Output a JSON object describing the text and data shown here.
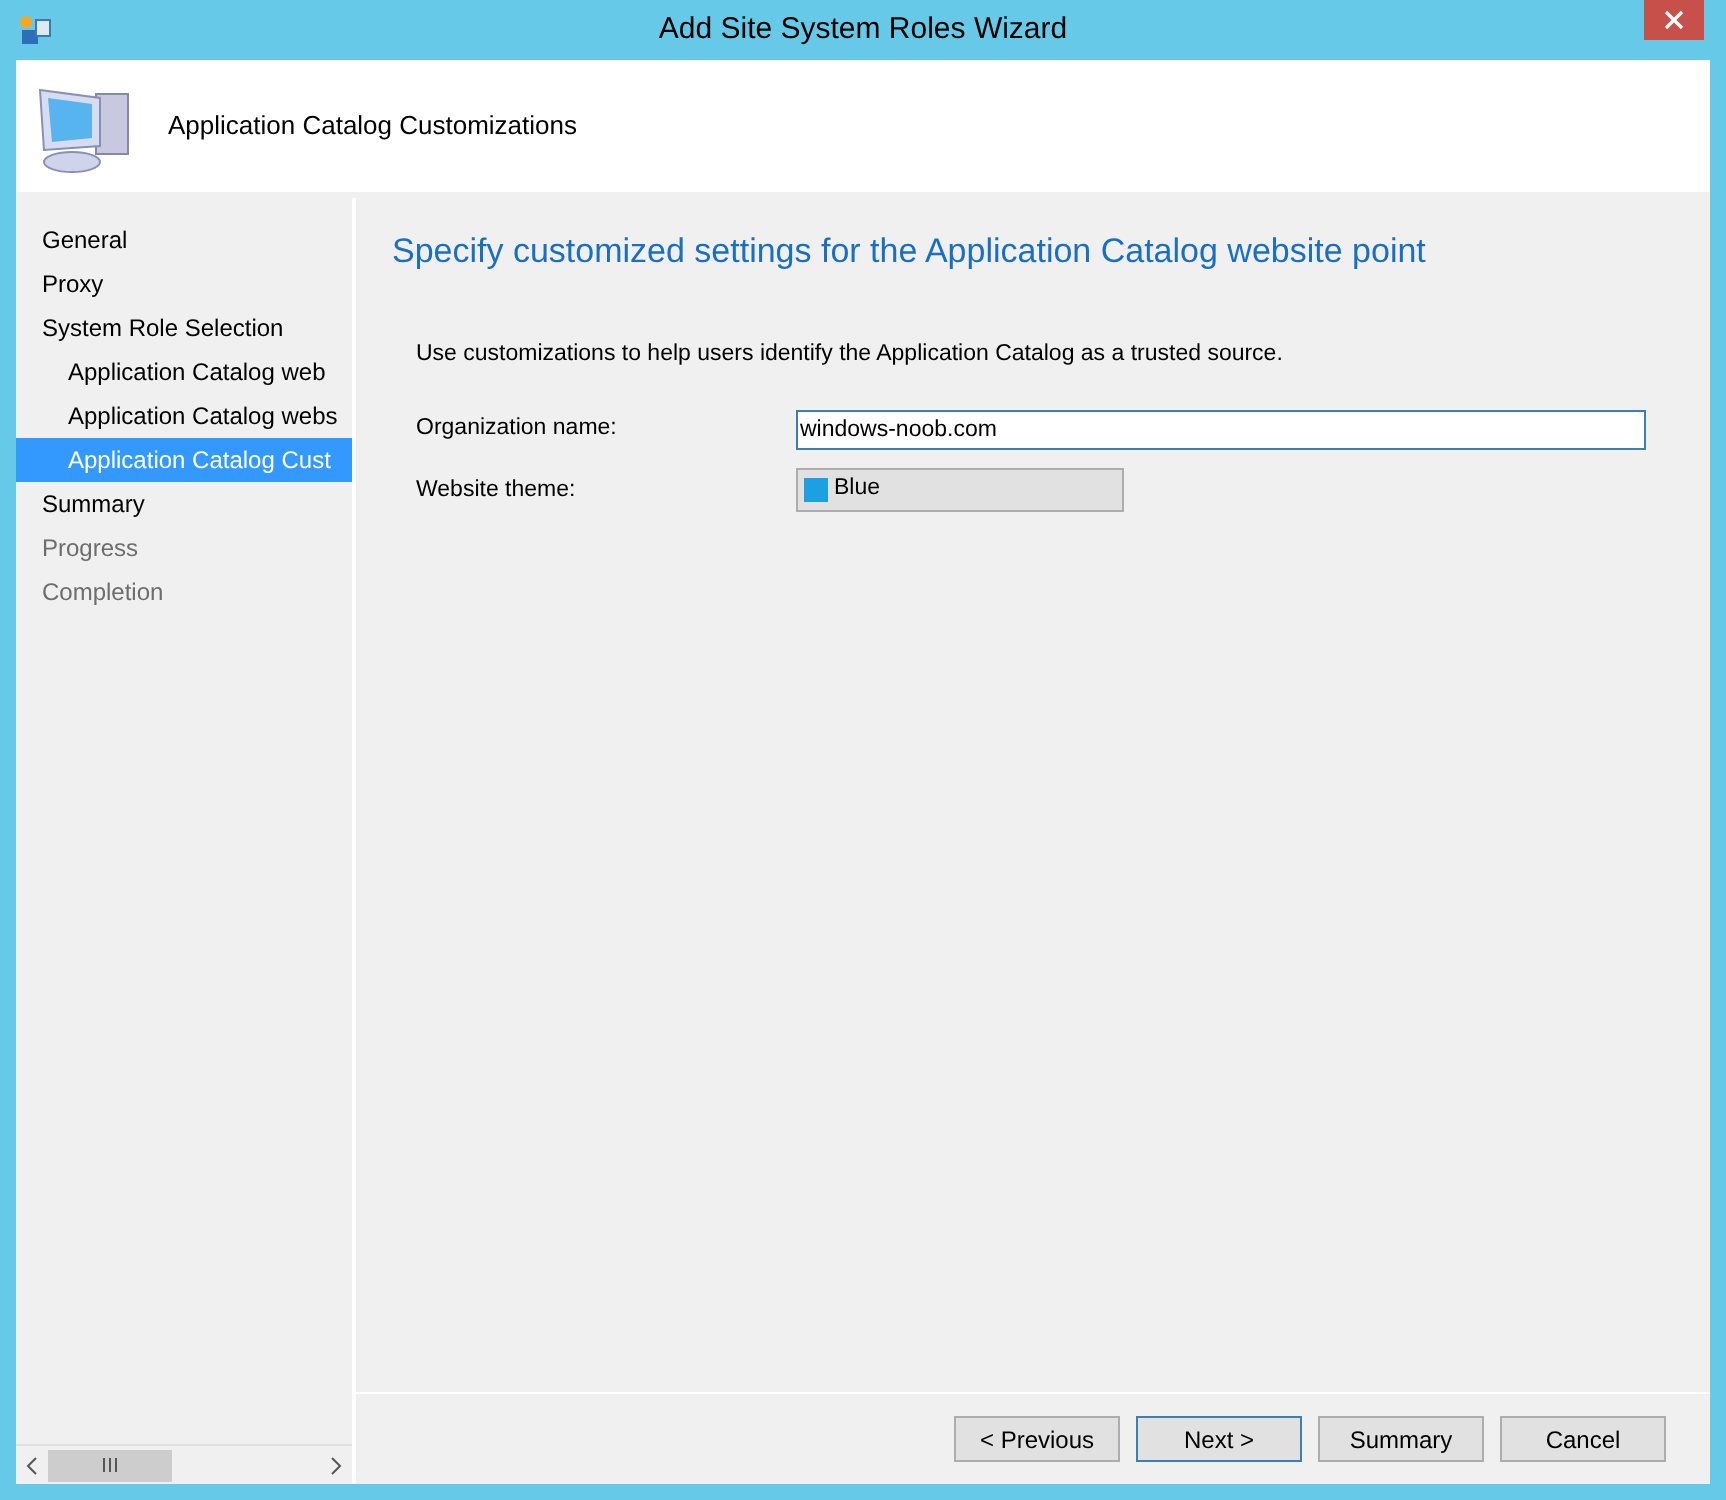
{
  "window": {
    "title": "Add Site System Roles Wizard"
  },
  "header": {
    "title": "Application Catalog Customizations"
  },
  "nav": [
    {
      "label": "General",
      "selected": false,
      "disabled": false
    },
    {
      "label": "Proxy",
      "selected": false,
      "disabled": false
    },
    {
      "label": "System Role Selection",
      "selected": false,
      "disabled": false,
      "children": [
        {
          "label": "Application Catalog web",
          "selected": false,
          "disabled": false
        },
        {
          "label": "Application Catalog webs",
          "selected": false,
          "disabled": false
        },
        {
          "label": "Application Catalog Cust",
          "selected": true,
          "disabled": false
        }
      ]
    },
    {
      "label": "Summary",
      "selected": false,
      "disabled": false
    },
    {
      "label": "Progress",
      "selected": false,
      "disabled": true
    },
    {
      "label": "Completion",
      "selected": false,
      "disabled": true
    }
  ],
  "page": {
    "heading": "Specify customized settings for the Application Catalog website point",
    "description": "Use customizations to help users identify the Application Catalog as a trusted source.",
    "organization": {
      "label": "Organization name:",
      "value": "windows-noob.com"
    },
    "theme": {
      "label": "Website theme:",
      "value": "Blue",
      "color": "#1ba1e2"
    }
  },
  "buttons": [
    {
      "label": "< Previous",
      "default": false
    },
    {
      "label": "Next >",
      "default": true
    },
    {
      "label": "Summary",
      "default": false
    },
    {
      "label": "Cancel",
      "default": false
    }
  ]
}
